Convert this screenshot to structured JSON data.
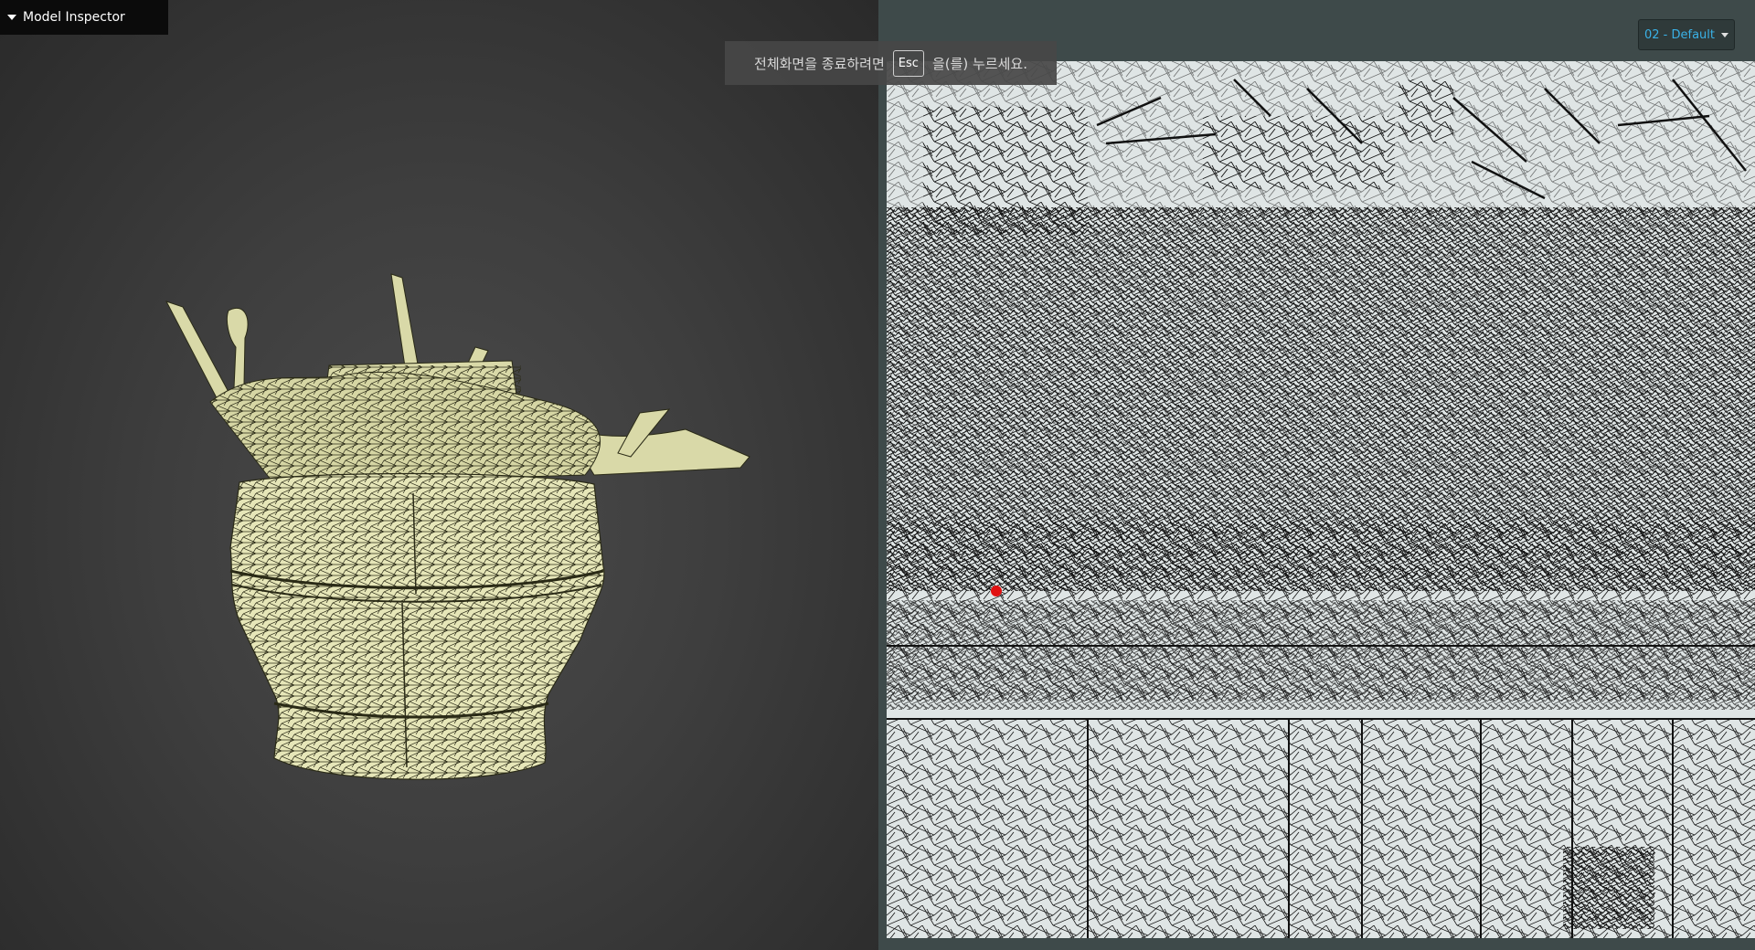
{
  "inspector": {
    "title": "Model Inspector",
    "caret_icon": "caret-down-icon"
  },
  "fullscreen_notice": {
    "prefix": "전체화면을 종료하려면",
    "key": "Esc",
    "suffix": "을(를) 누르세요."
  },
  "map_selector": {
    "selected": "02 - Default",
    "icon": "chevron-down-icon"
  },
  "colors": {
    "viewport_bg": "#3e3e3e",
    "mesh_fill": "#e6e6b8",
    "mesh_wire": "#2a2a16",
    "uv_bg": "#dfe5e5",
    "uv_wire": "#111111",
    "panel_bg": "#3e4a4a",
    "accent": "#3ab1e6",
    "marker": "#e01010"
  }
}
